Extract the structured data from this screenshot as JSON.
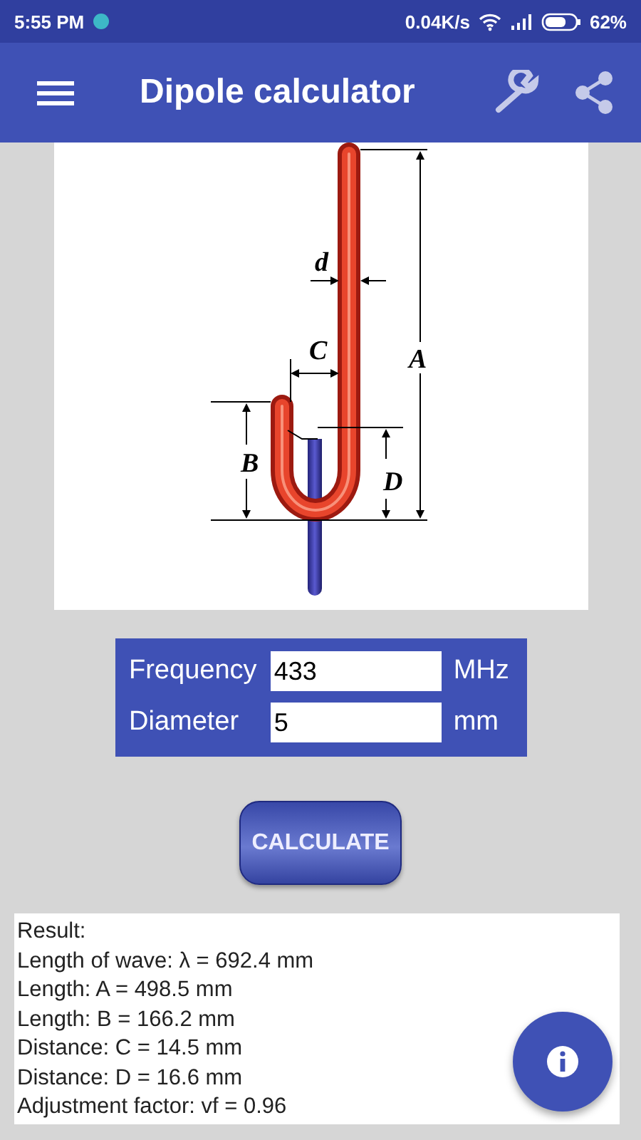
{
  "status_bar": {
    "time": "5:55 PM",
    "speed": "0.04K/s",
    "battery": "62%"
  },
  "app_bar": {
    "title": "Dipole calculator"
  },
  "diagram": {
    "labels": [
      {
        "kind": "d",
        "text": "d"
      },
      {
        "kind": "C",
        "text": "C"
      },
      {
        "kind": "A",
        "text": "A"
      },
      {
        "kind": "B",
        "text": "B"
      },
      {
        "kind": "D",
        "text": "D"
      }
    ]
  },
  "inputs": [
    {
      "label": "Frequency",
      "value": "433",
      "unit": "MHz"
    },
    {
      "label": "Diameter",
      "value": "5",
      "unit": "mm"
    }
  ],
  "calculate_button": "CALCULATE",
  "result": [
    "Result:",
    "Length of wave: λ = 692.4 mm",
    "Length: A = 498.5 mm",
    "Length: B = 166.2 mm",
    "Distance: C = 14.5 mm",
    "Distance: D = 16.6 mm",
    "Adjustment factor: vf = 0.96"
  ]
}
